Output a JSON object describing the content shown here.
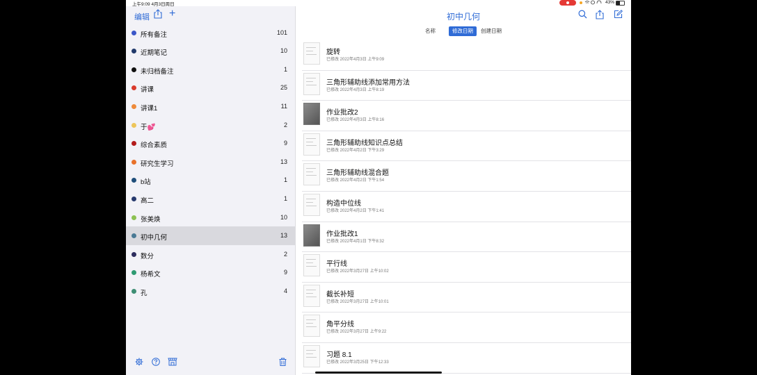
{
  "status": {
    "time": "上午9:09  4月3日周日",
    "battery": "43%"
  },
  "colors": {
    "accent": "#2f6bd6",
    "recording": "#e53935"
  },
  "sidebar": {
    "edit_label": "编辑",
    "add_label": "+",
    "items": [
      {
        "name": "所有备注",
        "count": "101",
        "color": "#3a56c8"
      },
      {
        "name": "近期笔记",
        "count": "10",
        "color": "#213a6b"
      },
      {
        "name": "未归档备注",
        "count": "1",
        "color": "#111111"
      },
      {
        "name": "讲课",
        "count": "25",
        "color": "#d93a2c"
      },
      {
        "name": "讲课1",
        "count": "11",
        "color": "#ee8a3a"
      },
      {
        "name": "于💕",
        "count": "2",
        "color": "#edc55a"
      },
      {
        "name": "综合素质",
        "count": "9",
        "color": "#b31b1b"
      },
      {
        "name": "研究生学习",
        "count": "13",
        "color": "#e8712a"
      },
      {
        "name": "b站",
        "count": "1",
        "color": "#1f4e7a"
      },
      {
        "name": "高二",
        "count": "1",
        "color": "#273a6e"
      },
      {
        "name": "张美焕",
        "count": "10",
        "color": "#8cc152"
      },
      {
        "name": "初中几何",
        "count": "13",
        "color": "#4a7a95"
      },
      {
        "name": "数分",
        "count": "2",
        "color": "#2d2d5e"
      },
      {
        "name": "杨希文",
        "count": "9",
        "color": "#2e9a72"
      },
      {
        "name": "孔",
        "count": "4",
        "color": "#3e8e74"
      }
    ],
    "selected_index": 11
  },
  "main": {
    "title": "初中几何",
    "sort": {
      "options": [
        "名称",
        "修改日期",
        "创建日期"
      ],
      "selected": "修改日期"
    },
    "notes": [
      {
        "title": "旋转",
        "date": "已修改 2022年4月3日 上午9:09",
        "thumb": "doc"
      },
      {
        "title": "三角形辅助线添加常用方法",
        "date": "已修改 2022年4月3日 上午8:19",
        "thumb": "doc"
      },
      {
        "title": "作业批改2",
        "date": "已修改 2022年4月3日 上午8:16",
        "thumb": "photo"
      },
      {
        "title": "三角形辅助线知识点总结",
        "date": "已修改 2022年4月2日 下午3:29",
        "thumb": "doc"
      },
      {
        "title": "三角形辅助线混合题",
        "date": "已修改 2022年4月2日 下午1:54",
        "thumb": "doc"
      },
      {
        "title": "构造中位线",
        "date": "已修改 2022年4月2日 下午1:41",
        "thumb": "doc"
      },
      {
        "title": "作业批改1",
        "date": "已修改 2022年4月1日 下午8:32",
        "thumb": "photo"
      },
      {
        "title": "平行线",
        "date": "已修改 2022年3月27日 上午10:02",
        "thumb": "doc"
      },
      {
        "title": "截长补短",
        "date": "已修改 2022年3月27日 上午10:01",
        "thumb": "doc"
      },
      {
        "title": "角平分线",
        "date": "已修改 2022年3月27日 上午9:22",
        "thumb": "doc"
      },
      {
        "title": "习题 8.1",
        "date": "已修改 2022年3月25日 下午12:33",
        "thumb": "doc"
      }
    ]
  }
}
